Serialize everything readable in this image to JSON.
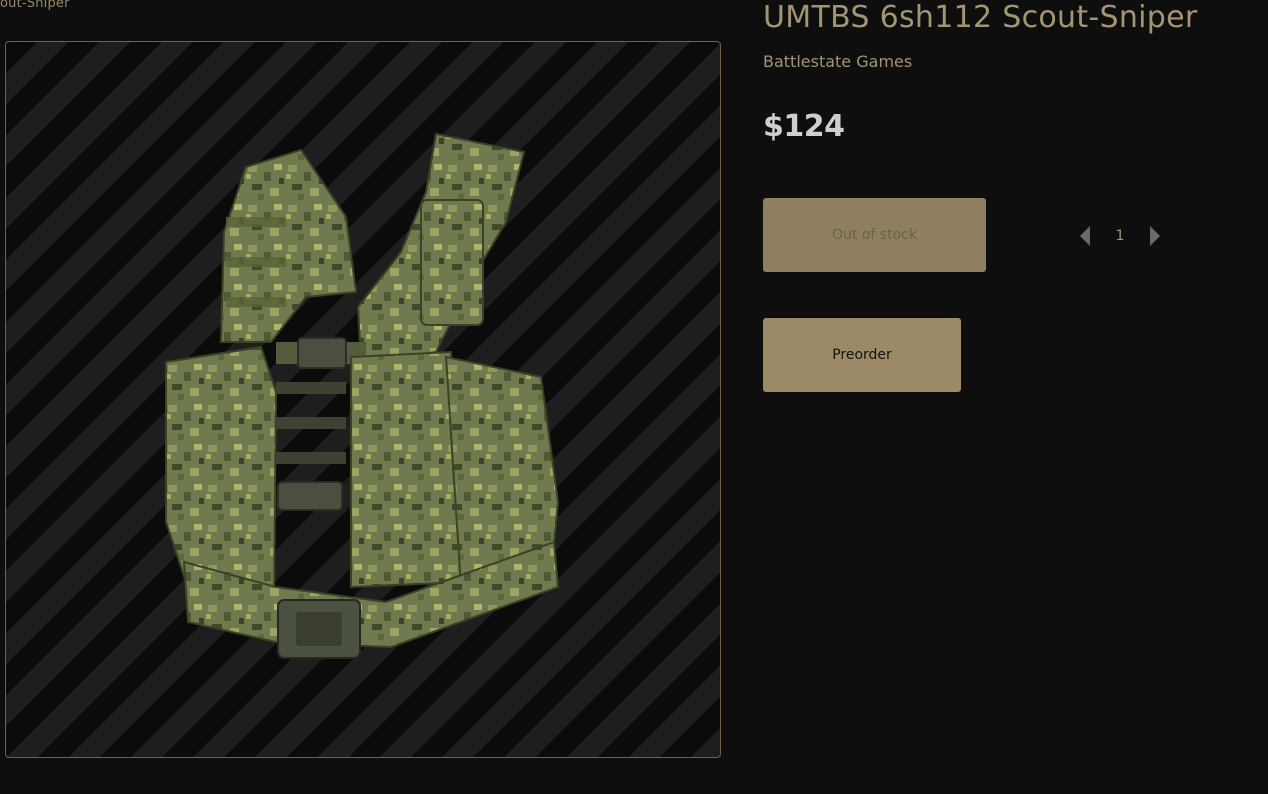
{
  "breadcrumb": {
    "text": "out-Sniper"
  },
  "product": {
    "title": "UMTBS 6sh112 Scout-Sniper",
    "brand": "Battlestate Games",
    "price": "$124",
    "image_alt": "UMTBS 6sh112 Scout-Sniper vest"
  },
  "actions": {
    "stock_label": "Out of stock",
    "preorder_label": "Preorder"
  },
  "quantity": {
    "value": "1",
    "decrement_icon": "triangle-left-icon",
    "increment_icon": "triangle-right-icon"
  },
  "colors": {
    "background": "#0e0e0e",
    "accent": "#a39472",
    "button": "#9c8a66",
    "price": "#cfcfcf"
  }
}
